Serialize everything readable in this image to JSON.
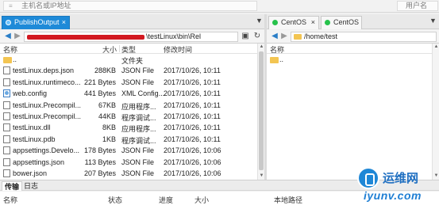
{
  "toolbar": {
    "host_placeholder": "主机名或IP地址",
    "user_placeholder": "用户名"
  },
  "left_tab": {
    "label": "PublishOutput",
    "close": "×"
  },
  "right_tabs": [
    {
      "label": "CentOS",
      "close": "×"
    },
    {
      "label": "CentOS"
    }
  ],
  "tab_more": "▼",
  "left_path": {
    "visible_text": "\\testLinux\\bin\\Rel"
  },
  "right_path": {
    "text": "/home/test"
  },
  "left_columns": {
    "name": "名称",
    "size": "大小",
    "type": "类型",
    "modified": "修改时间"
  },
  "left_files": [
    {
      "name": "..",
      "size": "",
      "type": "文件夹",
      "modified": "",
      "icon": "parent-folder-icon"
    },
    {
      "name": "testLinux.deps.json",
      "size": "288KB",
      "type": "JSON File",
      "modified": "2017/10/26, 10:11",
      "icon": "file-icon"
    },
    {
      "name": "testLinux.runtimeco...",
      "size": "221 Bytes",
      "type": "JSON File",
      "modified": "2017/10/26, 10:11",
      "icon": "file-icon"
    },
    {
      "name": "web.config",
      "size": "441 Bytes",
      "type": "XML Config...",
      "modified": "2017/10/26, 10:11",
      "icon": "web-config-icon"
    },
    {
      "name": "testLinux.Precompil...",
      "size": "67KB",
      "type": "应用程序...",
      "modified": "2017/10/26, 10:11",
      "icon": "file-icon"
    },
    {
      "name": "testLinux.Precompil...",
      "size": "44KB",
      "type": "程序调试...",
      "modified": "2017/10/26, 10:11",
      "icon": "file-icon"
    },
    {
      "name": "testLinux.dll",
      "size": "8KB",
      "type": "应用程序...",
      "modified": "2017/10/26, 10:11",
      "icon": "file-icon"
    },
    {
      "name": "testLinux.pdb",
      "size": "1KB",
      "type": "程序调试...",
      "modified": "2017/10/26, 10:11",
      "icon": "file-icon"
    },
    {
      "name": "appsettings.Develo...",
      "size": "178 Bytes",
      "type": "JSON File",
      "modified": "2017/10/26, 10:06",
      "icon": "file-icon"
    },
    {
      "name": "appsettings.json",
      "size": "113 Bytes",
      "type": "JSON File",
      "modified": "2017/10/26, 10:06",
      "icon": "file-icon"
    },
    {
      "name": "bower.json",
      "size": "207 Bytes",
      "type": "JSON File",
      "modified": "2017/10/26, 10:06",
      "icon": "file-icon"
    }
  ],
  "right_files": [
    {
      "name": "..",
      "icon": "parent-folder-icon"
    }
  ],
  "bottom_tabs": [
    "传输",
    "日志"
  ],
  "transfer_columns": [
    "名称",
    "状态",
    "进度",
    "大小",
    "本地路径"
  ],
  "watermark": {
    "brand": "运维网",
    "domain": "iyunv.com"
  },
  "colors": {
    "active_tab": "#1e8ad8",
    "online_dot": "#27c24c",
    "redaction": "#d21820",
    "folder": "#f3c552"
  }
}
